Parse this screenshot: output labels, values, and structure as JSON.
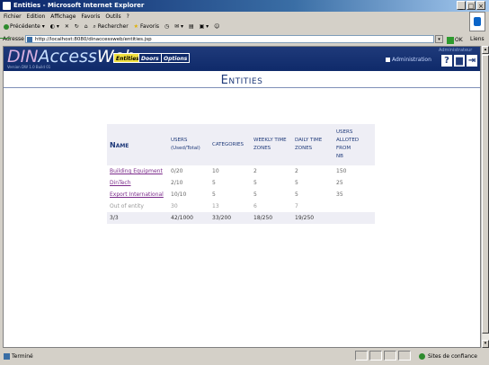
{
  "window": {
    "title": "Entities - Microsoft Internet Explorer"
  },
  "menu": [
    "Fichier",
    "Edition",
    "Affichage",
    "Favoris",
    "Outils",
    "?"
  ],
  "toolbar": {
    "back": "Précédente",
    "search": "Rechercher",
    "favorites": "Favoris"
  },
  "address": {
    "label": "Adresse",
    "url": "http://localhost:8080/dinaccessweb/entities.jsp",
    "go": "OK",
    "links": "Liens"
  },
  "app": {
    "logo_part1": "DIN",
    "logo_part2": "Access",
    "logo_part3": "Web",
    "logo_sub": "Version DW 1.0 Build 01",
    "nav": [
      "Entities",
      "Doors",
      "Options"
    ],
    "admin_top": "Administrateur",
    "admin_link": "Administration",
    "icons": [
      "help-icon",
      "save-icon",
      "logout-icon"
    ]
  },
  "page": {
    "title": "Entities"
  },
  "table": {
    "headers": {
      "name": "Name",
      "users": "Users",
      "users_sub": "(Used/Total)",
      "categories": "Categories",
      "weekly1": "Weekly time",
      "weekly2": "zones",
      "daily1": "Daily time",
      "daily2": "zones",
      "allot1": "Users",
      "allot2": "alloted from",
      "allot3": "NB"
    },
    "rows": [
      {
        "name": "Building Equipment",
        "users": "0/20",
        "categories": "10",
        "weekly": "2",
        "daily": "2",
        "allotted": "150"
      },
      {
        "name": "DinTech",
        "users": "2/10",
        "categories": "5",
        "weekly": "5",
        "daily": "5",
        "allotted": "25"
      },
      {
        "name": "Export International",
        "users": "10/10",
        "categories": "5",
        "weekly": "5",
        "daily": "5",
        "allotted": "35"
      },
      {
        "name": "Out of entity",
        "users": "30",
        "categories": "13",
        "weekly": "6",
        "daily": "7",
        "allotted": ""
      }
    ],
    "total": {
      "name": "3/3",
      "users": "42/1000",
      "categories": "33/200",
      "weekly": "18/250",
      "daily": "19/250",
      "allotted": ""
    }
  },
  "status": {
    "left": "Terminé",
    "zone": "Sites de confiance"
  }
}
